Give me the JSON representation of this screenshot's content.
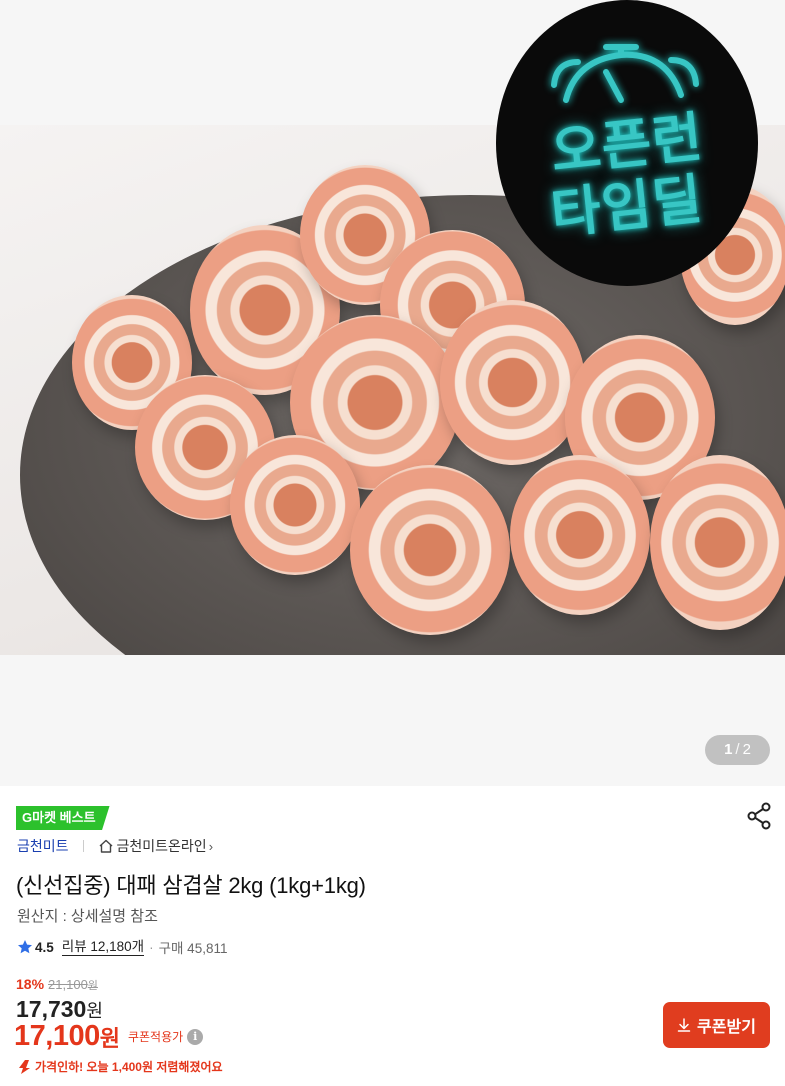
{
  "gallery": {
    "badge": {
      "line1": "오픈런",
      "line2": "타임딜"
    },
    "pager": {
      "current": "1",
      "separator": "/",
      "total": "2"
    }
  },
  "product": {
    "tag": "G마켓 베스트",
    "seller": "금천미트",
    "store_link": "금천미트온라인",
    "title": "(신선집중) 대패 삼겹살 2kg (1kg+1kg)",
    "origin": "원산지 : 상세설명 참조",
    "rating": "4.5",
    "review_label": "리뷰 12,180개",
    "purchase_label": "구매 45,811",
    "discount": "18%",
    "original_price": "21,100",
    "original_unit": "원",
    "price": "17,730",
    "price_unit": "원",
    "coupon_price": "17,100",
    "coupon_unit": "원",
    "coupon_label": "쿠폰적용가",
    "info_icon": "i",
    "price_drop_strong": "가격인하!",
    "price_drop_text": "오늘 1,400원 저렴해졌어요",
    "coupon_button": "쿠폰받기"
  },
  "colors": {
    "accent_red": "#e4361b",
    "badge_green": "#2cc12c",
    "seller_blue": "#1a3fb0",
    "neon_cyan": "#38c6c4"
  },
  "icons": [
    "share-icon",
    "home-icon",
    "star-icon",
    "info-icon",
    "arrow-down-icon",
    "download-icon",
    "alarm-clock-icon"
  ]
}
